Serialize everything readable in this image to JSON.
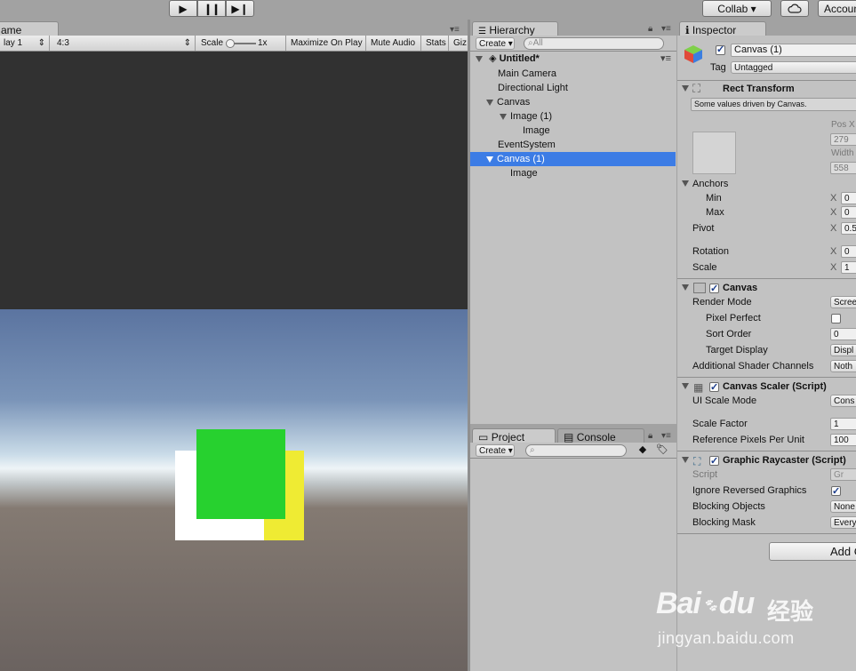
{
  "toolbar": {
    "play_icon": "play-icon",
    "pause_icon": "pause-icon",
    "step_icon": "step-icon",
    "collab_label": "Collab ▾",
    "cloud_icon": "cloud-icon",
    "account_label": "Accoun"
  },
  "game": {
    "tab_label": "ame",
    "display_label": "lay 1",
    "aspect_label": "4:3",
    "scale_label": "Scale",
    "scale_value": "1x",
    "maximize_label": "Maximize On Play",
    "mute_label": "Mute Audio",
    "stats_label": "Stats",
    "gizmos_label": "Giz"
  },
  "hierarchy": {
    "tab_label": "Hierarchy",
    "create_label": "Create ▾",
    "search_placeholder": "All",
    "scene_name": "Untitled*",
    "items": [
      {
        "label": "Main Camera"
      },
      {
        "label": "Directional Light"
      },
      {
        "label": "Canvas"
      },
      {
        "label": "Image (1)"
      },
      {
        "label": "Image"
      },
      {
        "label": "EventSystem"
      },
      {
        "label": "Canvas (1)"
      },
      {
        "label": "Image"
      }
    ]
  },
  "project": {
    "tab_label": "Project",
    "console_label": "Console",
    "create_label": "Create ▾"
  },
  "inspector": {
    "tab_label": "Inspector",
    "object_name": "Canvas (1)",
    "tag_label": "Tag",
    "tag_value": "Untagged",
    "rect_transform": {
      "title": "Rect Transform",
      "note": "Some values driven by Canvas.",
      "pos_x_label": "Pos X",
      "pos_x_value": "279",
      "width_label": "Width",
      "width_value": "558",
      "anchors_label": "Anchors",
      "min_label": "Min",
      "min_x": "0",
      "max_label": "Max",
      "max_x": "0",
      "pivot_label": "Pivot",
      "pivot_x": "0.5",
      "rotation_label": "Rotation",
      "rotation_x": "0",
      "scale_label": "Scale",
      "scale_x": "1",
      "x_label": "X"
    },
    "canvas": {
      "title": "Canvas",
      "render_mode_label": "Render Mode",
      "render_mode_value": "Scree",
      "pixel_perfect_label": "Pixel Perfect",
      "sort_order_label": "Sort Order",
      "sort_order_value": "0",
      "target_display_label": "Target Display",
      "target_display_value": "Displ",
      "shader_channels_label": "Additional Shader Channels",
      "shader_channels_value": "Noth"
    },
    "canvas_scaler": {
      "title": "Canvas Scaler (Script)",
      "ui_scale_mode_label": "UI Scale Mode",
      "ui_scale_mode_value": "Cons",
      "scale_factor_label": "Scale Factor",
      "scale_factor_value": "1",
      "ref_ppu_label": "Reference Pixels Per Unit",
      "ref_ppu_value": "100"
    },
    "raycaster": {
      "title": "Graphic Raycaster (Script)",
      "script_label": "Script",
      "script_value": "Gr",
      "ignore_reversed_label": "Ignore Reversed Graphics",
      "blocking_objects_label": "Blocking Objects",
      "blocking_objects_value": "None",
      "blocking_mask_label": "Blocking Mask",
      "blocking_mask_value": "Every"
    },
    "add_component_label": "Add C"
  },
  "watermark": {
    "brand": "Bai",
    "brand_tail": "du",
    "brand_cn": "经验",
    "url": "jingyan.baidu.com"
  },
  "colors": {
    "selection": "#3c7ce5",
    "green_square": "#27d12f",
    "yellow_rect": "#efeb33",
    "white_rect": "#ffffff"
  }
}
